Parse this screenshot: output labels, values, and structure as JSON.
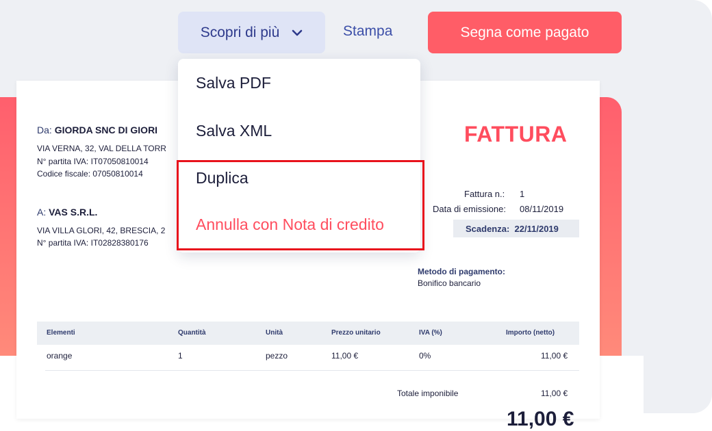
{
  "colors": {
    "accent": "#ff5d67",
    "title_red": "#ff4d5e",
    "primary_blue": "#2e3a8c",
    "highlight_red": "#e8121c"
  },
  "toolbar": {
    "more_label": "Scopri di più",
    "more_icon": "chevron-down-icon",
    "print_label": "Stampa",
    "mark_paid_label": "Segna come pagato"
  },
  "dropdown": {
    "items": [
      {
        "label": "Salva PDF"
      },
      {
        "label": "Salva XML"
      },
      {
        "label": "Duplica"
      },
      {
        "label": "Annulla con Nota di credito"
      }
    ]
  },
  "invoice": {
    "title": "FATTURA",
    "from": {
      "prefix": "Da:",
      "name": "GIORDA SNC DI GIORI",
      "address": "VIA VERNA, 32, VAL DELLA TORR",
      "vat": "N° partita IVA: IT07050810014",
      "tax_code": "Codice fiscale: 07050810014"
    },
    "to": {
      "prefix": "A:",
      "name": "VAS S.R.L.",
      "address": "VIA VILLA GLORI, 42, BRESCIA, 2",
      "vat": "N° partita IVA: IT02828380176"
    },
    "meta": {
      "number_label": "Fattura n.:",
      "number": "1",
      "issue_label": "Data di emissione:",
      "issue_date": "08/11/2019",
      "due_label": "Scadenza:",
      "due_date": "22/11/2019"
    },
    "payment": {
      "label": "Metodo di pagamento:",
      "value": "Bonifico bancario"
    },
    "table": {
      "headers": [
        "Elementi",
        "Quantità",
        "Unità",
        "Prezzo unitario",
        "IVA (%)",
        "Importo (netto)"
      ],
      "rows": [
        [
          "orange",
          "1",
          "pezzo",
          "11,00 €",
          "0%",
          "11,00 €"
        ]
      ]
    },
    "totals": {
      "taxable_label": "Totale imponibile",
      "taxable_value": "11,00 €",
      "grand_total": "11,00 €"
    }
  }
}
